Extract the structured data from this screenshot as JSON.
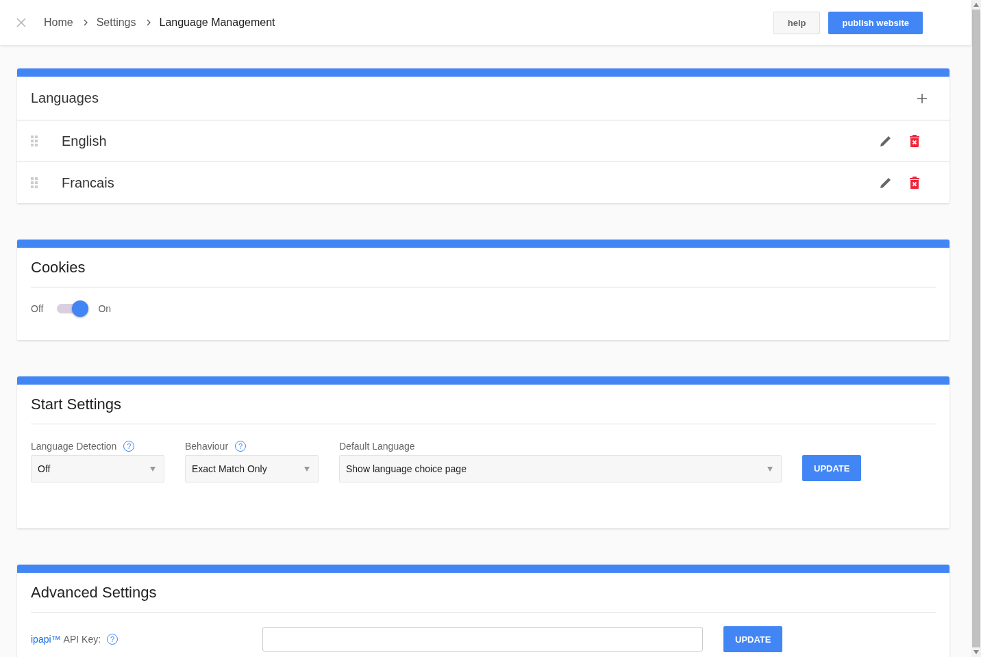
{
  "breadcrumb": [
    "Home",
    "Settings",
    "Language Management"
  ],
  "header_buttons": [
    {
      "label": "help",
      "kind": "secondary"
    },
    {
      "label": "publish website",
      "kind": "primary"
    }
  ],
  "languages": {
    "title": "Languages",
    "items": [
      {
        "name": "English"
      },
      {
        "name": "Francais"
      }
    ]
  },
  "cookies": {
    "title": "Cookies",
    "off_label": "Off",
    "on_label": "On",
    "on": true
  },
  "start_settings": {
    "title": "Start Settings",
    "fields": [
      {
        "label": "Language Detection",
        "help": "?",
        "value": "Off"
      },
      {
        "label": "Behaviour",
        "help": "?",
        "value": "Exact Match Only"
      },
      {
        "label": "Default Language",
        "value": "Show language choice page"
      }
    ],
    "button": "UPDATE"
  },
  "advanced_settings": {
    "title": "Advanced Settings",
    "link": "ipapi™",
    "label": "API Key:",
    "help": "?",
    "button": "UPDATE"
  }
}
